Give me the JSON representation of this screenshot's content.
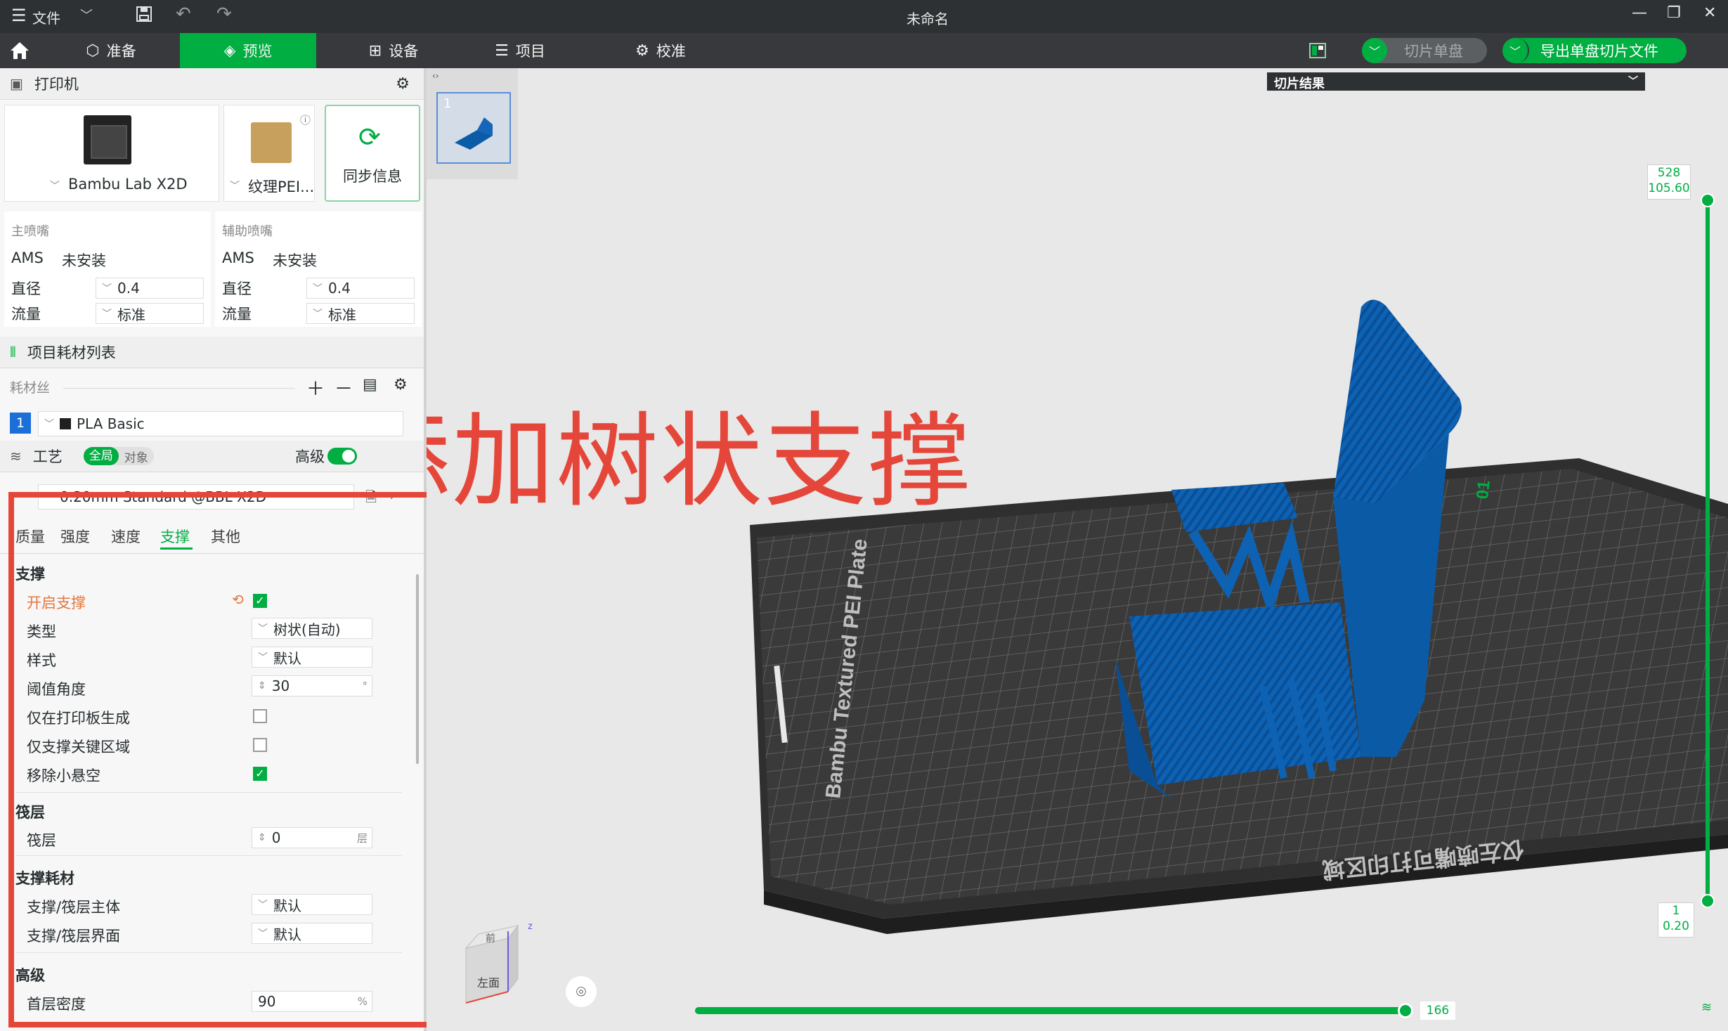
{
  "titlebar": {
    "menu_icon": "hamburger-icon",
    "file_label": "文件",
    "title": "未命名"
  },
  "nav": {
    "tabs": [
      {
        "label": "准备",
        "icon": "cube-icon",
        "active": false
      },
      {
        "label": "预览",
        "icon": "layers-icon",
        "active": true
      },
      {
        "label": "设备",
        "icon": "device-icon",
        "active": false
      },
      {
        "label": "项目",
        "icon": "list-icon",
        "active": false
      },
      {
        "label": "校准",
        "icon": "gear-icon",
        "active": false
      }
    ],
    "slice_button": "切片单盘",
    "export_button": "导出单盘切片文件",
    "accent": "#00ae42"
  },
  "printer": {
    "header": "打印机",
    "printer_name": "Bambu Lab X2D",
    "plate_name": "纹理PEI...",
    "sync_label": "同步信息",
    "main_nozzle": {
      "title": "主喷嘴",
      "ams_label": "AMS",
      "ams_value": "未安装",
      "diameter_label": "直径",
      "diameter_value": "0.4",
      "flow_label": "流量",
      "flow_value": "标准"
    },
    "aux_nozzle": {
      "title": "辅助喷嘴",
      "ams_label": "AMS",
      "ams_value": "未安装",
      "diameter_label": "直径",
      "diameter_value": "0.4",
      "flow_label": "流量",
      "flow_value": "标准"
    }
  },
  "filament": {
    "header": "项目耗材列表",
    "label": "耗材丝",
    "slot_number": "1",
    "slot_name": "PLA Basic"
  },
  "process": {
    "header": "工艺",
    "toggle_global": "全局",
    "toggle_object": "对象",
    "advanced_label": "高级",
    "preset": "0.20mm Standard @BBL X2D",
    "tabs": [
      "质量",
      "强度",
      "速度",
      "支撑",
      "其他"
    ],
    "active_tab": "支撑",
    "groups": {
      "support": {
        "title": "支撑",
        "enable_label": "开启支撑",
        "enable_checked": true,
        "type_label": "类型",
        "type_value": "树状(自动)",
        "style_label": "样式",
        "style_value": "默认",
        "threshold_label": "阈值角度",
        "threshold_value": "30",
        "threshold_unit": "°",
        "build_plate_only_label": "仅在打印板生成",
        "build_plate_only_checked": false,
        "critical_only_label": "仅支撑关键区域",
        "critical_only_checked": false,
        "remove_small_label": "移除小悬空",
        "remove_small_checked": true
      },
      "raft": {
        "title": "筏层",
        "layers_label": "筏层",
        "layers_value": "0",
        "layers_unit": "层"
      },
      "support_filament": {
        "title": "支撑耗材",
        "base_label": "支撑/筏层主体",
        "base_value": "默认",
        "interface_label": "支撑/筏层界面",
        "interface_value": "默认"
      },
      "advanced": {
        "title": "高级",
        "first_layer_density_label": "首层密度",
        "first_layer_density_value": "90",
        "first_layer_density_unit": "%"
      }
    }
  },
  "viewport": {
    "plate_number": "1",
    "slice_result_label": "切片结果",
    "annotation": "添加树状支撑",
    "bed_label": "Bambu Textured PEI Plate",
    "bed_area_label": "仅左喷嘴可打印区域",
    "bed_number": "01",
    "layer_top": {
      "layer": "528",
      "height": "105.60"
    },
    "layer_bottom": {
      "layer": "1",
      "height": "0.20"
    },
    "move_slider_value": "166",
    "cube_front": "左面",
    "cube_top": "前",
    "axis_z": "z"
  }
}
